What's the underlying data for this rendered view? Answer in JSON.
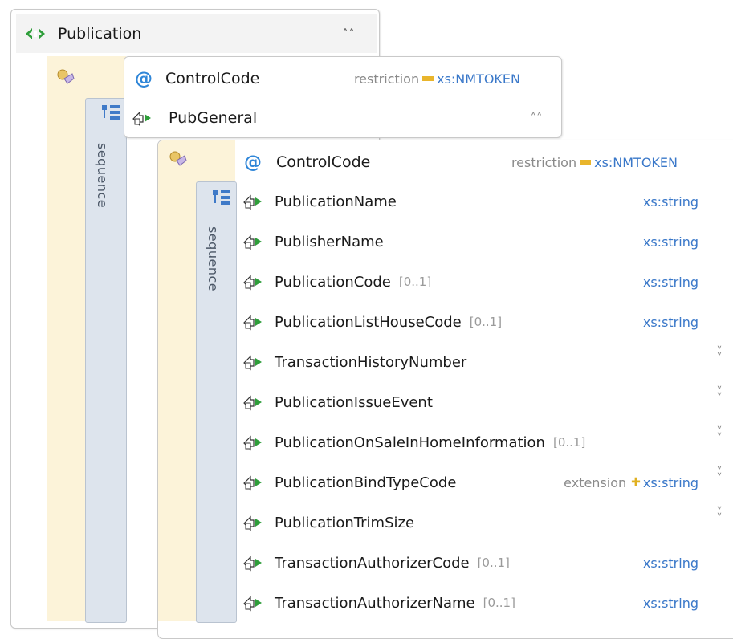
{
  "publication": {
    "name": "Publication",
    "attribute": {
      "name": "ControlCode",
      "restriction_label": "restriction",
      "type": "xs:NMTOKEN"
    },
    "compositor": "sequence",
    "child": {
      "name": "PubGeneral",
      "compositor": "sequence",
      "attribute": {
        "name": "ControlCode",
        "restriction_label": "restriction",
        "type": "xs:NMTOKEN"
      },
      "elements": [
        {
          "name": "PublicationName",
          "cardinality": "",
          "derivation": "",
          "type": "xs:string",
          "expandable": false
        },
        {
          "name": "PublisherName",
          "cardinality": "",
          "derivation": "",
          "type": "xs:string",
          "expandable": false
        },
        {
          "name": "PublicationCode",
          "cardinality": "[0..1]",
          "derivation": "",
          "type": "xs:string",
          "expandable": false
        },
        {
          "name": "PublicationListHouseCode",
          "cardinality": "[0..1]",
          "derivation": "",
          "type": "xs:string",
          "expandable": false
        },
        {
          "name": "TransactionHistoryNumber",
          "cardinality": "",
          "derivation": "",
          "type": "",
          "expandable": true
        },
        {
          "name": "PublicationIssueEvent",
          "cardinality": "",
          "derivation": "",
          "type": "",
          "expandable": true
        },
        {
          "name": "PublicationOnSaleInHomeInformation",
          "cardinality": "[0..1]",
          "derivation": "",
          "type": "",
          "expandable": true
        },
        {
          "name": "PublicationBindTypeCode",
          "cardinality": "",
          "derivation": "extension",
          "type": "xs:string",
          "expandable": true
        },
        {
          "name": "PublicationTrimSize",
          "cardinality": "",
          "derivation": "",
          "type": "",
          "expandable": true
        },
        {
          "name": "TransactionAuthorizerCode",
          "cardinality": "[0..1]",
          "derivation": "",
          "type": "xs:string",
          "expandable": false
        },
        {
          "name": "TransactionAuthorizerName",
          "cardinality": "[0..1]",
          "derivation": "",
          "type": "xs:string",
          "expandable": false
        }
      ]
    }
  },
  "icons": {
    "element": "element-arrow-icon",
    "collapse": "chevron-double-up-icon",
    "expand": "chevron-double-down-icon",
    "attributes": "attributes-group-icon",
    "sequence": "sequence-icon"
  },
  "colors": {
    "type_text": "#3a78c9",
    "element_icon_green": "#2e9e3a",
    "attribute_at": "#2f86d8",
    "yellow_column": "#fcf3d9",
    "sequence_column": "#dde4ed"
  }
}
